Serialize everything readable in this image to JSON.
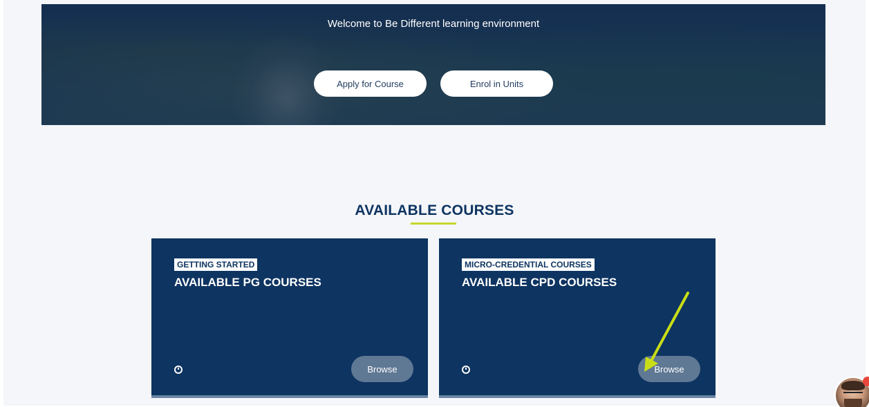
{
  "hero": {
    "welcome_text": "Welcome to Be Different learning environment",
    "apply_button": "Apply for Course",
    "enrol_button": "Enrol in Units"
  },
  "section": {
    "title": "AVAILABLE COURSES",
    "underline_color": "#c7d72b"
  },
  "cards": [
    {
      "tag": "GETTING STARTED",
      "title": "AVAILABLE PG COURSES",
      "icon": "clock-icon",
      "browse_label": "Browse"
    },
    {
      "tag": "MICRO-CREDENTIAL COURSES",
      "title": "AVAILABLE CPD COURSES",
      "icon": "clock-icon",
      "browse_label": "Browse"
    }
  ],
  "colors": {
    "brand_navy": "#0e3461",
    "browse_button": "#5f7894",
    "page_background": "#f4f6f9",
    "annotation_arrow": "#c9dd16",
    "notification_badge": "#e8473c"
  },
  "chat_widget": {
    "icon": "support-avatar"
  }
}
